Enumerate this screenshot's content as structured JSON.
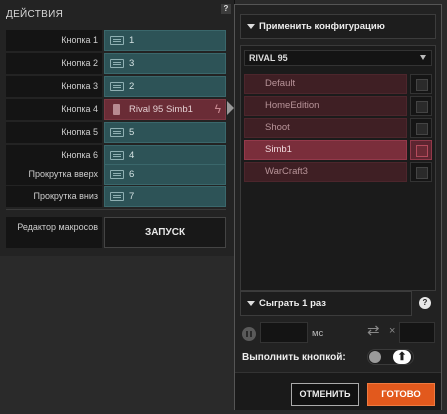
{
  "actions": {
    "title": "ДЕЙСТВИЯ",
    "help_label": "?",
    "rows": [
      {
        "label": "Кнопка 1",
        "value": "1",
        "icon": "keyboard-icon",
        "type": "key"
      },
      {
        "label": "Кнопка 2",
        "value": "3",
        "icon": "keyboard-icon",
        "type": "key"
      },
      {
        "label": "Кнопка 3",
        "value": "2",
        "icon": "keyboard-icon",
        "type": "key"
      },
      {
        "label": "Кнопка 4",
        "value": "Rival 95 Simb1",
        "icon": "macro-icon",
        "type": "macro",
        "extra_icon": "lightning-icon"
      },
      {
        "label": "Кнопка 5",
        "value": "5",
        "icon": "keyboard-icon",
        "type": "key"
      },
      {
        "label": "Кнопка 6",
        "value": "4",
        "icon": "keyboard-icon",
        "type": "key"
      },
      {
        "label": "Прокрутка вверх",
        "value": "6",
        "icon": "keyboard-icon",
        "type": "key"
      },
      {
        "label": "Прокрутка вниз",
        "value": "7",
        "icon": "keyboard-icon",
        "type": "key"
      }
    ],
    "macro_editor_label": "Редактор макросов",
    "run_button": "ЗАПУСК"
  },
  "config_panel": {
    "apply_dropdown": "Применить конфигурацию",
    "device": "RIVAL 95",
    "configs": [
      {
        "name": "Default",
        "selected": false
      },
      {
        "name": "HomeEdition",
        "selected": false
      },
      {
        "name": "Shoot",
        "selected": false
      },
      {
        "name": "Simb1",
        "selected": true
      },
      {
        "name": "WarCraft3",
        "selected": false
      }
    ],
    "play_dropdown": "Сыграть 1 раз",
    "help_label": "?",
    "delay_value": "",
    "delay_unit": "мс",
    "repeat_times_sign": "×",
    "repeat_value": "",
    "execute_label": "Выполнить кнопкой:",
    "toggle_up_glyph": "⬆",
    "cancel_button": "ОТМЕНИТЬ",
    "done_button": "ГОТОВО"
  },
  "colors": {
    "key_value_bg": "#2d5357",
    "macro_value_bg": "#6a2c36",
    "config_selected_bg": "#7a2e3b",
    "done_button_bg": "#e2591d"
  }
}
